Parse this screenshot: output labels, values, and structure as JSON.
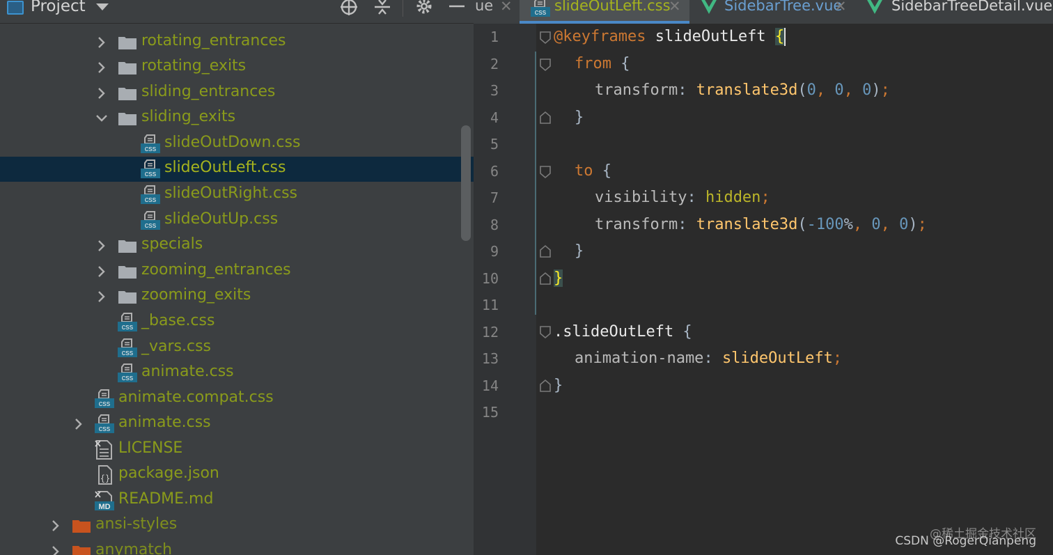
{
  "project_panel": {
    "title": "Project",
    "tree": [
      {
        "label": "rotating_entrances",
        "kind": "folder",
        "expanded": false
      },
      {
        "label": "rotating_exits",
        "kind": "folder",
        "expanded": false
      },
      {
        "label": "sliding_entrances",
        "kind": "folder",
        "expanded": false
      },
      {
        "label": "sliding_exits",
        "kind": "folder",
        "expanded": true
      },
      {
        "label": "slideOutDown.css",
        "kind": "css"
      },
      {
        "label": "slideOutLeft.css",
        "kind": "css",
        "selected": true
      },
      {
        "label": "slideOutRight.css",
        "kind": "css"
      },
      {
        "label": "slideOutUp.css",
        "kind": "css"
      },
      {
        "label": "specials",
        "kind": "folder",
        "expanded": false
      },
      {
        "label": "zooming_entrances",
        "kind": "folder",
        "expanded": false
      },
      {
        "label": "zooming_exits",
        "kind": "folder",
        "expanded": false
      },
      {
        "label": "_base.css",
        "kind": "css"
      },
      {
        "label": "_vars.css",
        "kind": "css"
      },
      {
        "label": "animate.css",
        "kind": "css"
      },
      {
        "label": "animate.compat.css",
        "kind": "css"
      },
      {
        "label": "animate.css",
        "kind": "css-collapsed"
      },
      {
        "label": "LICENSE",
        "kind": "text"
      },
      {
        "label": "package.json",
        "kind": "json"
      },
      {
        "label": "README.md",
        "kind": "md"
      },
      {
        "label": "ansi-styles",
        "kind": "orange-folder"
      },
      {
        "label": "anymatch",
        "kind": "orange-folder"
      }
    ]
  },
  "editor": {
    "tabs": [
      {
        "label": "ue",
        "active": false
      },
      {
        "label": "slideOutLeft.css",
        "active": true
      },
      {
        "label": "SidebarTree.vue",
        "active": false
      },
      {
        "label": "SidebarTreeDetail.vue",
        "active": false
      }
    ],
    "line_numbers": [
      "1",
      "2",
      "3",
      "4",
      "5",
      "6",
      "7",
      "8",
      "9",
      "10",
      "11",
      "12",
      "13",
      "14",
      "15"
    ],
    "code": {
      "l1_kw": "@keyframes",
      "l1_name": "slideOutLeft",
      "l2_kw": "from",
      "l3_prop": "transform",
      "l3_fn": "translate3d",
      "l7_kw": "to",
      "l7_prop": "visibility",
      "l7_val": "hidden",
      "l8_prop": "transform",
      "l8_fn": "translate3d",
      "l8_num": "-100",
      "l12_sel": ".slideOutLeft",
      "l13_prop": "animation-name",
      "l13_val": "slideOutLeft"
    }
  },
  "watermarks": {
    "juejin": "@稀土掘金技术社区",
    "csdn": "CSDN @RogerQianpeng"
  },
  "colors": {
    "panel_bg": "#3c3f41",
    "editor_bg": "#2b2b2b",
    "selection": "#0d293e",
    "tree_text": "#8a9b1b",
    "accent": "#4a88c7"
  }
}
